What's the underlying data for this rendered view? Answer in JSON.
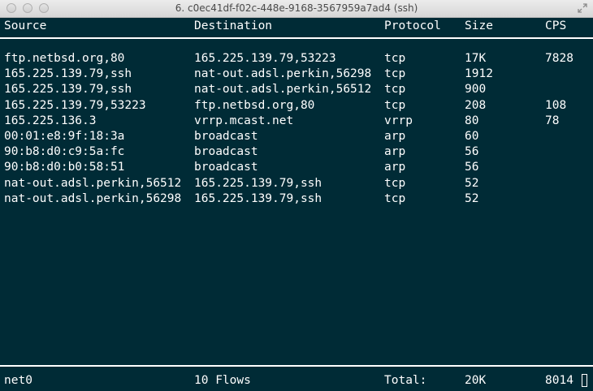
{
  "window": {
    "title": "6. c0ec41df-f02c-448e-9168-3567959a7ad4 (ssh)"
  },
  "columns": {
    "source": "Source",
    "destination": "Destination",
    "protocol": "Protocol",
    "size": "Size",
    "cps": "CPS"
  },
  "flows": [
    {
      "source": "ftp.netbsd.org,80",
      "destination": "165.225.139.79,53223",
      "protocol": "tcp",
      "size": "17K",
      "cps": "7828"
    },
    {
      "source": "165.225.139.79,ssh",
      "destination": "nat-out.adsl.perkin,56298",
      "protocol": "tcp",
      "size": "1912",
      "cps": ""
    },
    {
      "source": "165.225.139.79,ssh",
      "destination": "nat-out.adsl.perkin,56512",
      "protocol": "tcp",
      "size": "900",
      "cps": ""
    },
    {
      "source": "165.225.139.79,53223",
      "destination": "ftp.netbsd.org,80",
      "protocol": "tcp",
      "size": "208",
      "cps": "108"
    },
    {
      "source": "165.225.136.3",
      "destination": "vrrp.mcast.net",
      "protocol": "vrrp",
      "size": "80",
      "cps": "78"
    },
    {
      "source": "00:01:e8:9f:18:3a",
      "destination": "broadcast",
      "protocol": "arp",
      "size": "60",
      "cps": ""
    },
    {
      "source": "90:b8:d0:c9:5a:fc",
      "destination": "broadcast",
      "protocol": "arp",
      "size": "56",
      "cps": ""
    },
    {
      "source": "90:b8:d0:b0:58:51",
      "destination": "broadcast",
      "protocol": "arp",
      "size": "56",
      "cps": ""
    },
    {
      "source": "nat-out.adsl.perkin,56512",
      "destination": "165.225.139.79,ssh",
      "protocol": "tcp",
      "size": "52",
      "cps": ""
    },
    {
      "source": "nat-out.adsl.perkin,56298",
      "destination": "165.225.139.79,ssh",
      "protocol": "tcp",
      "size": "52",
      "cps": ""
    }
  ],
  "footer": {
    "interface": "net0",
    "flow_count": "10 Flows",
    "total_label": "Total:",
    "total_size": "20K",
    "total_cps": "8014"
  },
  "colors": {
    "background": "#002b36",
    "foreground": "#ffffff"
  }
}
